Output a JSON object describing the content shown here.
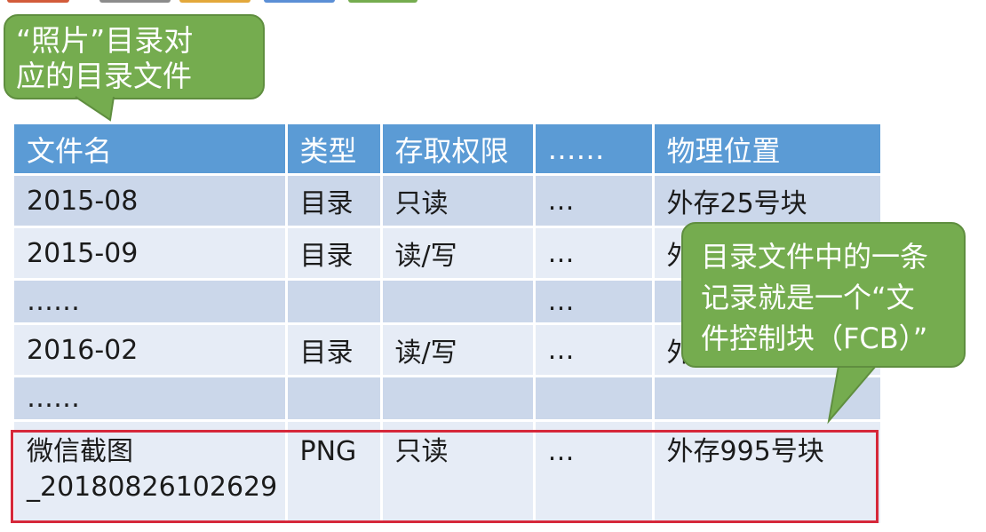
{
  "callouts": {
    "left": {
      "lines": [
        "“照片”目录对",
        "应的目录文件"
      ]
    },
    "right": {
      "lines": [
        "目录文件中的一条",
        "记录就是一个“文",
        "件控制块（FCB）”"
      ]
    }
  },
  "table": {
    "headers": [
      "文件名",
      "类型",
      "存取权限",
      "……",
      "物理位置"
    ],
    "rows": [
      [
        "2015-08",
        "目录",
        "只读",
        "…",
        "外存25号块"
      ],
      [
        "2015-09",
        "目录",
        "读/写",
        "…",
        "外"
      ],
      [
        "……",
        "",
        "",
        "…",
        ""
      ],
      [
        "2016-02",
        "目录",
        "读/写",
        "…",
        "外"
      ],
      [
        "……",
        "",
        "",
        "",
        ""
      ]
    ],
    "highlighted_row": {
      "name_line1": "微信截图",
      "name_line2": "_20180826102629",
      "type": "PNG",
      "access": "只读",
      "more": "…",
      "location": "外存995号块"
    }
  },
  "colors": {
    "header": "#5b9bd5",
    "row_dark": "#cbd7ea",
    "row_light": "#e6ecf6",
    "callout": "#75ac4f",
    "highlight_border": "#d6283a"
  }
}
